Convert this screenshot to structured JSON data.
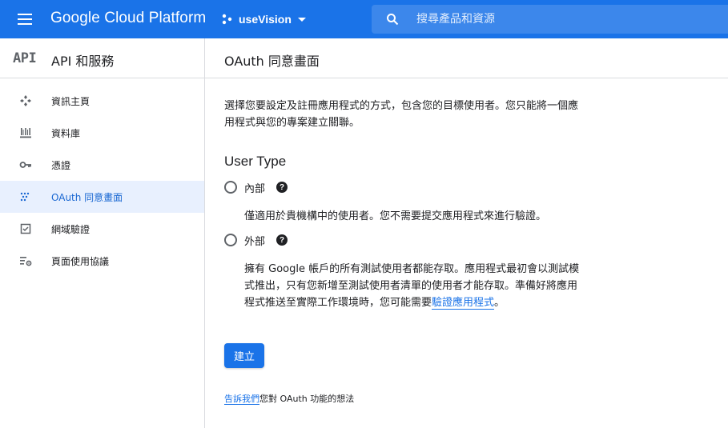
{
  "topbar": {
    "brand": "Google Cloud Platform",
    "project_name": "useVision",
    "search_placeholder": "搜尋產品和資源",
    "colors": {
      "background": "#1a73e8"
    }
  },
  "sidebar": {
    "logo_text": "API",
    "title": "API 和服務",
    "items": [
      {
        "label": "資訊主頁",
        "icon": "dashboard-icon",
        "active": false
      },
      {
        "label": "資料庫",
        "icon": "library-icon",
        "active": false
      },
      {
        "label": "憑證",
        "icon": "key-icon",
        "active": false
      },
      {
        "label": "OAuth 同意畫面",
        "icon": "oauth-consent-icon",
        "active": true
      },
      {
        "label": "網域驗證",
        "icon": "checkbox-icon",
        "active": false
      },
      {
        "label": "頁面使用協議",
        "icon": "settings-list-icon",
        "active": false
      }
    ]
  },
  "main": {
    "title": "OAuth 同意畫面",
    "intro_line1": "選擇您要設定及註冊應用程式的方式，包含您的目標使用者。您只能將一個應",
    "intro_line2": "用程式與您的專案建立關聯。",
    "user_type_title": "User Type",
    "options": [
      {
        "label": "內部",
        "desc_lines": [
          "僅適用於貴機構中的使用者。您不需要提交應用程式來進行驗證。"
        ]
      },
      {
        "label": "外部",
        "desc_line1": "擁有 Google 帳戶的所有測試使用者都能存取。應用程式最初會以測試模",
        "desc_line2": "式推出，只有您新增至測試使用者清單的使用者才能存取。準備好將應用",
        "desc_line3_prefix": "程式推送至實際工作環境時，您可能需要",
        "desc_link": "驗證應用程式",
        "desc_line3_suffix": "。"
      }
    ],
    "create_button": "建立",
    "feedback_link": "告訴我們",
    "feedback_text": "您對 OAuth 功能的想法"
  }
}
